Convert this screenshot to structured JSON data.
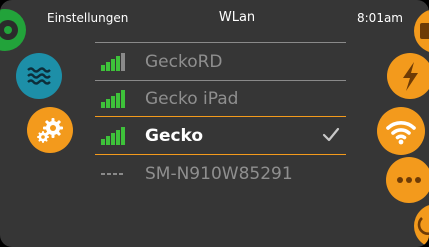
{
  "header": {
    "left_label": "Einstellungen",
    "title": "WLan",
    "time": "8:01am"
  },
  "networks": [
    {
      "name": "GeckoRD",
      "signal": "full",
      "selected": false
    },
    {
      "name": "Gecko iPad",
      "signal": "full",
      "selected": false
    },
    {
      "name": "Gecko",
      "signal": "full",
      "selected": true
    },
    {
      "name": "SM-N910W85291",
      "signal": "none",
      "selected": false
    }
  ],
  "left_buttons": [
    "music-icon",
    "water-waves-icon",
    "settings-gears-icon"
  ],
  "right_buttons": [
    "lock-icon",
    "lightning-icon",
    "wifi-icon",
    "more-dots-icon",
    "power-icon"
  ],
  "colors": {
    "background": "#363636",
    "accent_orange": "#f39a1c",
    "music_green": "#22a33a",
    "water_teal": "#1d8fa8",
    "signal_green": "#3ec23a",
    "signal_inactive": "#8a8a8a",
    "text_inactive": "#8f8f8f"
  }
}
